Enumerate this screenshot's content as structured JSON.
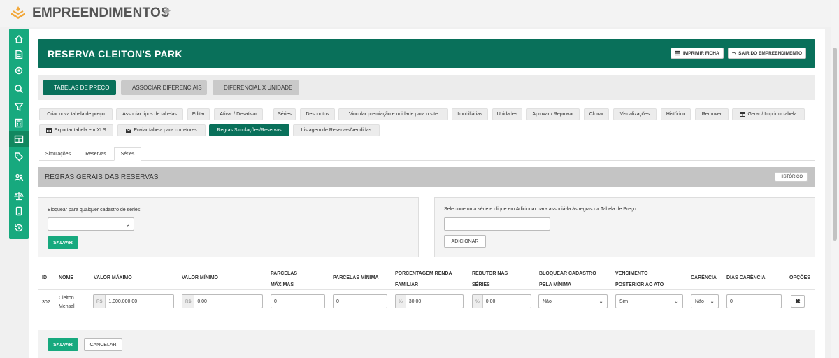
{
  "app": {
    "title": "EMPREENDIMENTOS"
  },
  "page": {
    "title": "RESERVA CLEITON'S PARK",
    "print_label": "IMPRIMIR FICHA",
    "exit_label": "SAIR DO EMPREENDIMENTO"
  },
  "main_tabs": [
    {
      "label": "TABELAS DE PREÇO"
    },
    {
      "label": "ASSOCIAR DIFERENCIAIS"
    },
    {
      "label": "DIFERENCIAL X UNIDADE"
    }
  ],
  "actions": [
    "Criar nova tabela de preço",
    "Associar tipos de tabelas",
    "Editar",
    "Ativar / Desativar",
    "Séries",
    "Descontos",
    "Vincular premiação e unidade para o site",
    "Imobiliárias",
    "Unidades",
    "Aprovar / Reprovar",
    "Clonar",
    "Visualizações",
    "Histórico",
    "Remover",
    "Gerar / Imprimir tabela",
    "Exportar tabela em XLS",
    "Enviar tabela para corretores",
    "Regras Simulações/Reservas",
    "Listagem de Reservas/Vendidas"
  ],
  "subtabs": [
    "Simulações",
    "Reservas",
    "Séries"
  ],
  "section": {
    "title": "REGRAS GERAIS DAS RESERVAS",
    "history_label": "HISTÓRICO"
  },
  "block_box": {
    "label": "Bloquear para qualquer cadastro de séries:",
    "save_label": "SALVAR"
  },
  "series_box": {
    "label": "Selecione uma série e clique em Adicionar para associá-la às regras da Tabela de Preço:",
    "add_label": "ADICIONAR"
  },
  "table": {
    "headers": {
      "id": "ID",
      "nome": "NOME",
      "valor_max": "VALOR MÁXIMO",
      "valor_min": "VALOR MÍNIMO",
      "parcelas_max_1": "PARCELAS",
      "parcelas_max_2": "MÁXIMAS",
      "parcelas_min": "PARCELAS MÍNIMA",
      "porc_1": "PORCENTAGEM RENDA",
      "porc_2": "FAMILIAR",
      "redutor_1": "REDUTOR NAS",
      "redutor_2": "SÉRIES",
      "bloq_1": "BLOQUEAR CADASTRO",
      "bloq_2": "PELA MÍNIMA",
      "venc_1": "VENCIMENTO",
      "venc_2": "POSTERIOR AO ATO",
      "carencia": "CARÊNCIA",
      "dias_carencia": "DIAS CARÊNCIA",
      "opcoes": "OPÇÕES"
    },
    "row": {
      "id": "302",
      "nome_1": "Cleiton",
      "nome_2": "Mensal",
      "valor_max_prefix": "R$",
      "valor_max": "1.000.000,00",
      "valor_min_prefix": "R$",
      "valor_min": "0,00",
      "parcelas_max": "0",
      "parcelas_min": "0",
      "porc_prefix": "%",
      "porc": "30,00",
      "redutor_prefix": "%",
      "redutor": "0,00",
      "bloquear": "Não",
      "vencimento": "Sim",
      "carencia": "Não",
      "dias_carencia": "0"
    }
  },
  "footer": {
    "save_label": "SALVAR",
    "cancel_label": "CANCELAR"
  },
  "colors": {
    "primary": "#09705a",
    "accent": "#17a97e",
    "logo": "#f2a83b"
  }
}
